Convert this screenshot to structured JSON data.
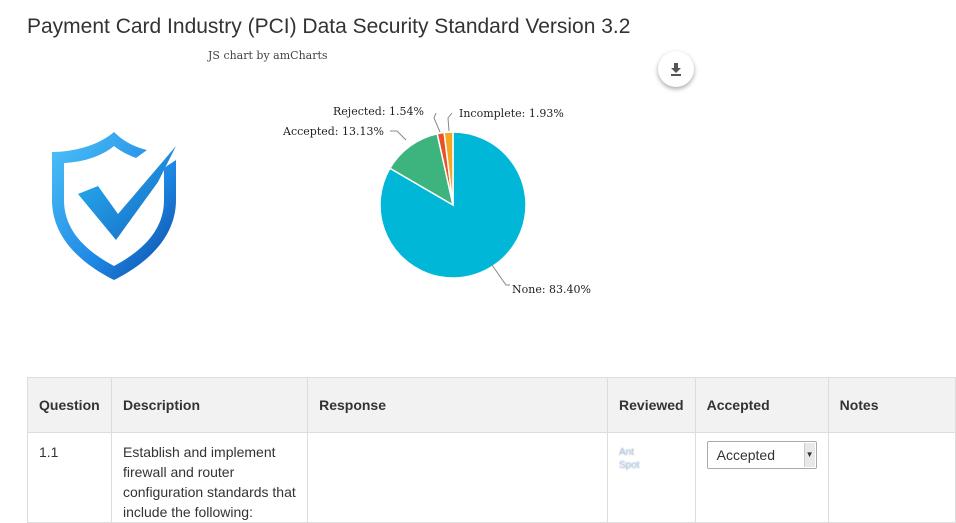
{
  "page": {
    "title": "Payment Card Industry (PCI) Data Security Standard Version 3.2"
  },
  "chart": {
    "credit": "JS chart by amCharts",
    "download_icon": "download-icon",
    "labels": {
      "rejected": "Rejected: 1.54%",
      "accepted": "Accepted: 13.13%",
      "incomplete": "Incomplete: 1.93%",
      "none": "None: 83.40%"
    }
  },
  "chart_data": {
    "type": "pie",
    "series": [
      {
        "name": "None",
        "value": 83.4,
        "color": "#00b7d8"
      },
      {
        "name": "Accepted",
        "value": 13.13,
        "color": "#3db37e"
      },
      {
        "name": "Rejected",
        "value": 1.54,
        "color": "#e8522b"
      },
      {
        "name": "Incomplete",
        "value": 1.93,
        "color": "#f5a623"
      }
    ]
  },
  "table": {
    "headers": {
      "question": "Question",
      "description": "Description",
      "response": "Response",
      "reviewed": "Reviewed",
      "accepted": "Accepted",
      "notes": "Notes"
    },
    "rows": [
      {
        "question": "1.1",
        "description": "Establish and implement firewall and router configuration standards that include the following:",
        "response": "",
        "reviewed_line1": "Ant",
        "reviewed_line2": "Spot",
        "accepted": "Accepted",
        "notes": ""
      }
    ]
  },
  "colors": {
    "shield_light": "#29b6f6",
    "shield_dark": "#0d47a1"
  }
}
